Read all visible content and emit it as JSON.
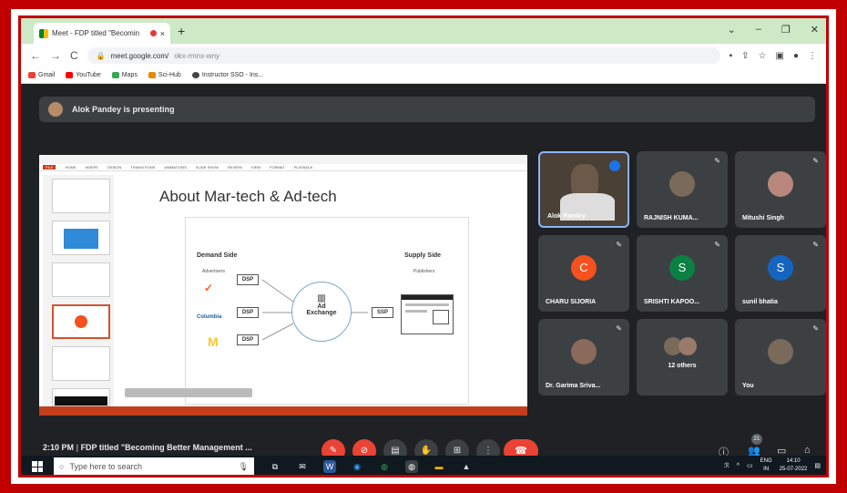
{
  "browser": {
    "tab_title": "Meet - FDP titled \"Becomin",
    "tab_close": "×",
    "new_tab": "+",
    "url": "meet.google.com/",
    "url_rest": "okx-rmnx-wny",
    "bookmarks": [
      "Gmail",
      "YouTube",
      "Maps",
      "Sci-Hub",
      "Instructor SSO - Ins..."
    ]
  },
  "meet": {
    "presenting_text": "Alok Pandey is presenting",
    "meeting_time": "2:10 PM",
    "meeting_title": "FDP titled \"Becoming Better Management ...",
    "participant_count": "21",
    "tiles": [
      {
        "name": "Alok Pandey",
        "initial": "",
        "color": "#5f6368"
      },
      {
        "name": "RAJNISH KUMA...",
        "initial": "",
        "color": "#7a6a5a"
      },
      {
        "name": "Mitushi Singh",
        "initial": "",
        "color": "#b8867a"
      },
      {
        "name": "CHARU SIJORIA",
        "initial": "C",
        "color": "#f4511e"
      },
      {
        "name": "SRISHTI KAPOO...",
        "initial": "S",
        "color": "#0b8043"
      },
      {
        "name": "sunil bhatia",
        "initial": "S",
        "color": "#1565c0"
      },
      {
        "name": "Dr. Garima Sriva...",
        "initial": "",
        "color": "#8a6a5a"
      },
      {
        "name": "12 others",
        "initial": "",
        "color": "#7a6a5a"
      },
      {
        "name": "You",
        "initial": "",
        "color": "#7a6a5a"
      }
    ]
  },
  "slide": {
    "title": "About Mar-tech & Ad-tech",
    "demand_side": "Demand Side",
    "advertisers": "Advertisers",
    "supply_side": "Supply Side",
    "publishers": "Publishers",
    "dsp": "DSP",
    "ssp": "SSP",
    "exchange_line1": "Ad",
    "exchange_line2": "Exchange",
    "brand_columbia": "Columbia"
  },
  "taskbar": {
    "search_placeholder": "Type here to search",
    "lang": "ENG",
    "region": "IN",
    "time": "14:10",
    "date": "25-07-2022"
  }
}
